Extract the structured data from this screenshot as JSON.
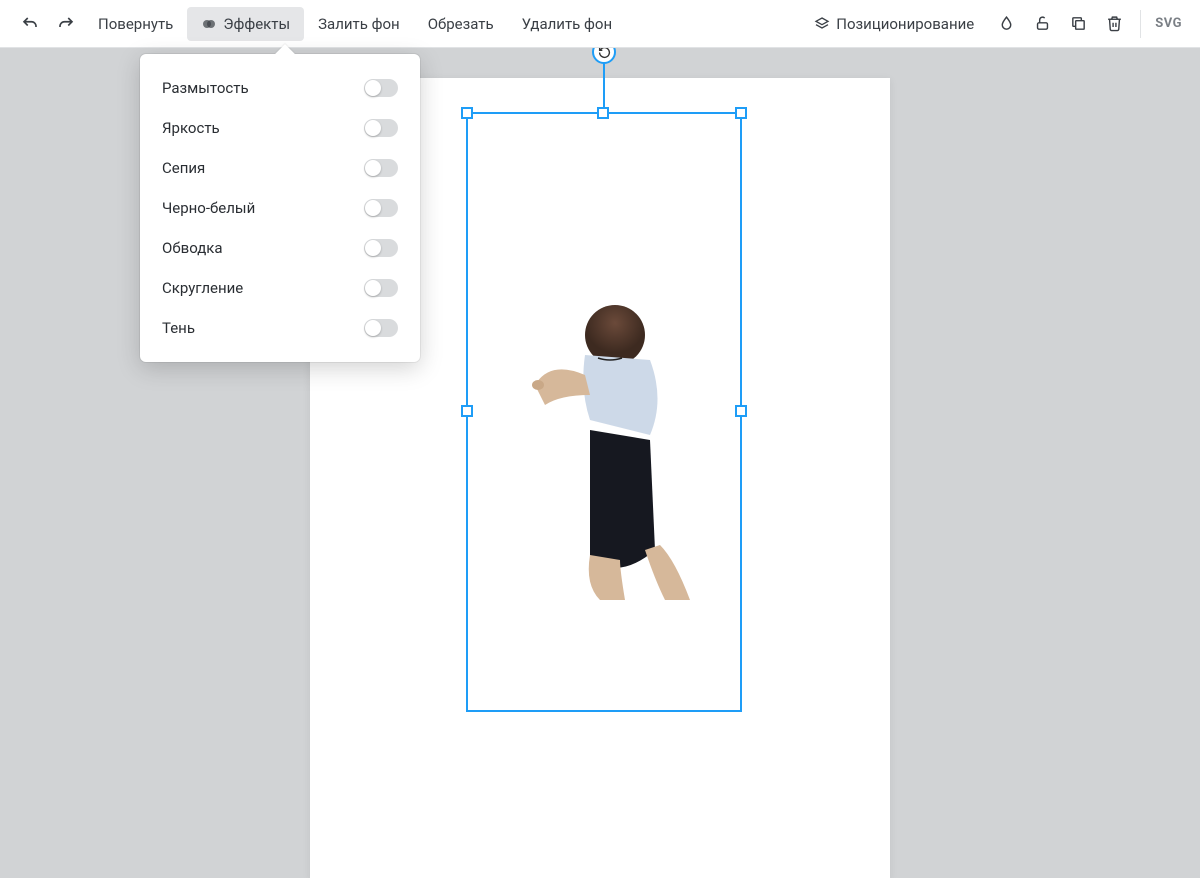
{
  "toolbar": {
    "rotate": "Повернуть",
    "effects": "Эффекты",
    "fill_bg": "Залить фон",
    "crop": "Обрезать",
    "remove_bg": "Удалить фон",
    "positioning": "Позиционирование",
    "format_badge": "SVG"
  },
  "effects_menu": {
    "items": [
      {
        "label": "Размытость",
        "on": false
      },
      {
        "label": "Яркость",
        "on": false
      },
      {
        "label": "Сепия",
        "on": false
      },
      {
        "label": "Черно-белый",
        "on": false
      },
      {
        "label": "Обводка",
        "on": false
      },
      {
        "label": "Скругление",
        "on": false
      },
      {
        "label": "Тень",
        "on": false
      }
    ]
  },
  "colors": {
    "selection": "#1e9df7",
    "canvas_bg": "#d1d3d5"
  }
}
